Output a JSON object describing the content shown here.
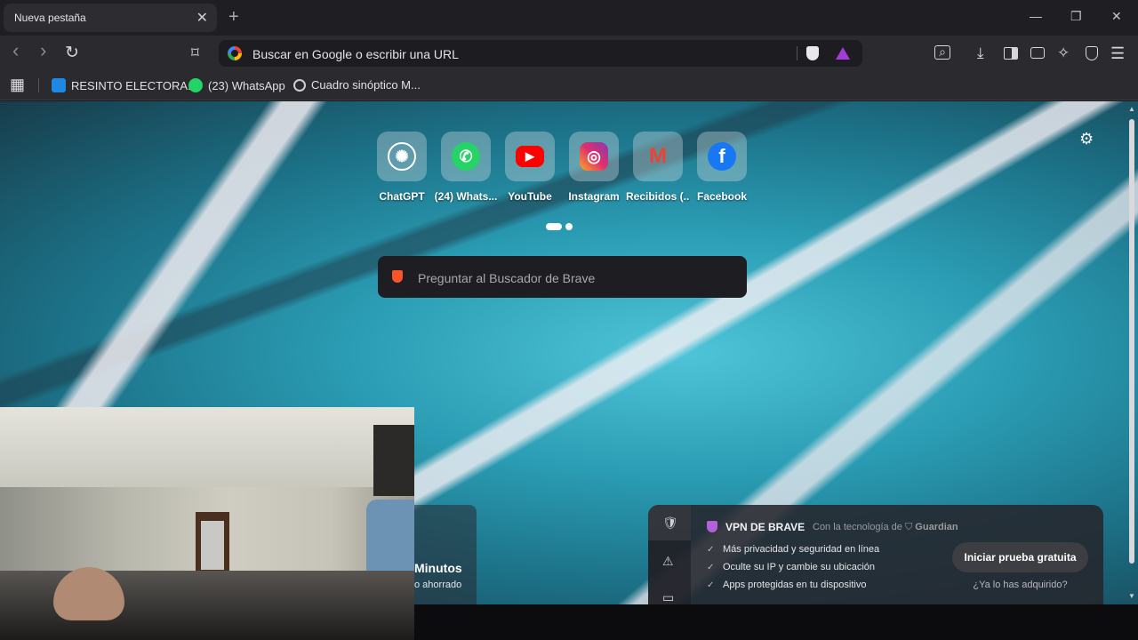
{
  "tab": {
    "title": "Nueva pestaña",
    "close": "✕",
    "new_tab": "+"
  },
  "window_controls": {
    "minimize": "—",
    "restore": "❐",
    "close": "✕"
  },
  "toolbar": {
    "back": "‹",
    "forward": "›",
    "reload": "↻",
    "bookmark": "⌑",
    "url_placeholder": "Buscar en Google o escribir una URL",
    "icons": [
      "search-tab-icon",
      "downloads-icon",
      "sidebar-icon",
      "wallet-icon",
      "leo-ai-icon",
      "vpn-icon",
      "menu-icon"
    ]
  },
  "bookmarks": {
    "apps_icon": "▦",
    "items": [
      {
        "label": "RESINTO ELECTORA...",
        "icon": "folder-icon",
        "color": "#1e88e5"
      },
      {
        "label": "(23) WhatsApp",
        "icon": "whatsapp-icon",
        "color": "#25d366"
      },
      {
        "label": "Cuadro sinóptico M...",
        "icon": "chatgpt-icon",
        "color": "#cfcfd3"
      }
    ]
  },
  "top_sites": [
    {
      "label": "ChatGPT",
      "logo": "✺",
      "color": "#ffffff"
    },
    {
      "label": "(24) Whats...",
      "logo": "✆",
      "color": "#25d366"
    },
    {
      "label": "YouTube",
      "logo": "▶",
      "color": "#ff0000"
    },
    {
      "label": "Instagram",
      "logo": "◎",
      "color": "#e1306c"
    },
    {
      "label": "Recibidos (...",
      "logo": "M",
      "color": "#ea4335"
    },
    {
      "label": "Facebook",
      "logo": "f",
      "color": "#1877f2"
    }
  ],
  "search": {
    "placeholder": "Preguntar al Buscador de Brave"
  },
  "settings_icon": "⚙",
  "stats": {
    "value": "Minutos",
    "label": "o ahorrado"
  },
  "vpn": {
    "title": "VPN DE BRAVE",
    "powered_by": "Con la tecnología de",
    "provider": "Guardian",
    "features": [
      "Más privacidad y seguridad en línea",
      "Oculte su IP y cambie su ubicación",
      "Apps protegidas en tu dispositivo"
    ],
    "cta": "Iniciar prueba gratuita",
    "already": "¿Ya lo has adquirido?",
    "rail_icons": [
      "🛡",
      "⚠",
      "▭"
    ],
    "check": "✓"
  }
}
